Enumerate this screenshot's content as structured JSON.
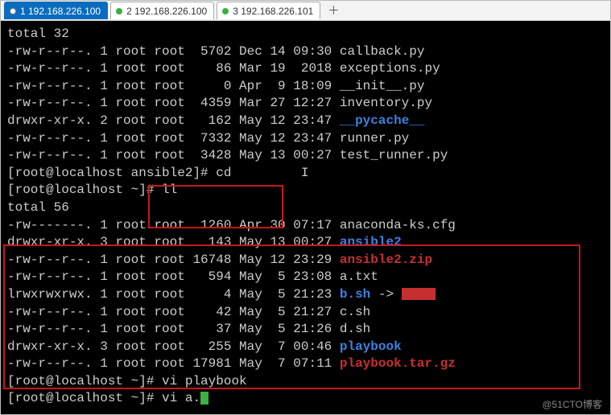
{
  "tabs": [
    {
      "label": "1 192.168.226.100",
      "active": true
    },
    {
      "label": "2 192.168.226.100",
      "active": false
    },
    {
      "label": "3 192.168.226.101",
      "active": false
    }
  ],
  "term": {
    "total_top": "total 32",
    "listing_top": [
      {
        "perm": "-rw-r--r--.",
        "n": "1",
        "u": "root",
        "g": "root",
        "sz": "5702",
        "mon": "Dec",
        "d": "14",
        "t": "09:30",
        "name": "callback.py",
        "cls": ""
      },
      {
        "perm": "-rw-r--r--.",
        "n": "1",
        "u": "root",
        "g": "root",
        "sz": "86",
        "mon": "Mar",
        "d": "19",
        "t": " 2018",
        "name": "exceptions.py",
        "cls": ""
      },
      {
        "perm": "-rw-r--r--.",
        "n": "1",
        "u": "root",
        "g": "root",
        "sz": "0",
        "mon": "Apr",
        "d": " 9",
        "t": "18:09",
        "name": "__init__.py",
        "cls": ""
      },
      {
        "perm": "-rw-r--r--.",
        "n": "1",
        "u": "root",
        "g": "root",
        "sz": "4359",
        "mon": "Mar",
        "d": "27",
        "t": "12:27",
        "name": "inventory.py",
        "cls": ""
      },
      {
        "perm": "drwxr-xr-x.",
        "n": "2",
        "u": "root",
        "g": "root",
        "sz": "162",
        "mon": "May",
        "d": "12",
        "t": "23:47",
        "name": "__pycache__",
        "cls": "dir"
      },
      {
        "perm": "-rw-r--r--.",
        "n": "1",
        "u": "root",
        "g": "root",
        "sz": "7332",
        "mon": "May",
        "d": "12",
        "t": "23:47",
        "name": "runner.py",
        "cls": ""
      },
      {
        "perm": "-rw-r--r--.",
        "n": "1",
        "u": "root",
        "g": "root",
        "sz": "3428",
        "mon": "May",
        "d": "13",
        "t": "00:27",
        "name": "test_runner.py",
        "cls": ""
      }
    ],
    "prompt_cd": "[root@localhost ansible2]# cd",
    "prompt_ll": "[root@localhost ~]# ll",
    "total_mid": "total 56",
    "listing_mid": [
      {
        "perm": "-rw-------.",
        "n": "1",
        "u": "root",
        "g": "root",
        "sz": "1260",
        "mon": "Apr",
        "d": "30",
        "t": "07:17",
        "name": "anaconda-ks.cfg",
        "cls": ""
      },
      {
        "perm": "drwxr-xr-x.",
        "n": "3",
        "u": "root",
        "g": "root",
        "sz": "143",
        "mon": "May",
        "d": "13",
        "t": "00:27",
        "name": "ansible2",
        "cls": "dir"
      },
      {
        "perm": "-rw-r--r--.",
        "n": "1",
        "u": "root",
        "g": "root",
        "sz": "16748",
        "mon": "May",
        "d": "12",
        "t": "23:29",
        "name": "ansible2.zip",
        "cls": "arch"
      },
      {
        "perm": "-rw-r--r--.",
        "n": "1",
        "u": "root",
        "g": "root",
        "sz": "594",
        "mon": "May",
        "d": " 5",
        "t": "23:08",
        "name": "a.txt",
        "cls": ""
      },
      {
        "perm": "lrwxrwxrwx.",
        "n": "1",
        "u": "root",
        "g": "root",
        "sz": "4",
        "mon": "May",
        "d": " 5",
        "t": "21:23",
        "name": "b.sh",
        "cls": "dir",
        "arrow": " -> ",
        "lnk": true
      },
      {
        "perm": "-rw-r--r--.",
        "n": "1",
        "u": "root",
        "g": "root",
        "sz": "42",
        "mon": "May",
        "d": " 5",
        "t": "21:27",
        "name": "c.sh",
        "cls": ""
      },
      {
        "perm": "-rw-r--r--.",
        "n": "1",
        "u": "root",
        "g": "root",
        "sz": "37",
        "mon": "May",
        "d": " 5",
        "t": "21:26",
        "name": "d.sh",
        "cls": ""
      },
      {
        "perm": "drwxr-xr-x.",
        "n": "3",
        "u": "root",
        "g": "root",
        "sz": "255",
        "mon": "May",
        "d": " 7",
        "t": "00:46",
        "name": "playbook",
        "cls": "dir"
      },
      {
        "perm": "-rw-r--r--.",
        "n": "1",
        "u": "root",
        "g": "root",
        "sz": "17981",
        "mon": "May",
        "d": " 7",
        "t": "07:11",
        "name": "playbook.tar.gz",
        "cls": "arch"
      }
    ],
    "prompt_vi1": "[root@localhost ~]# vi playbook",
    "prompt_vi2": "[root@localhost ~]# vi a."
  },
  "watermark": "@51CTO博客"
}
